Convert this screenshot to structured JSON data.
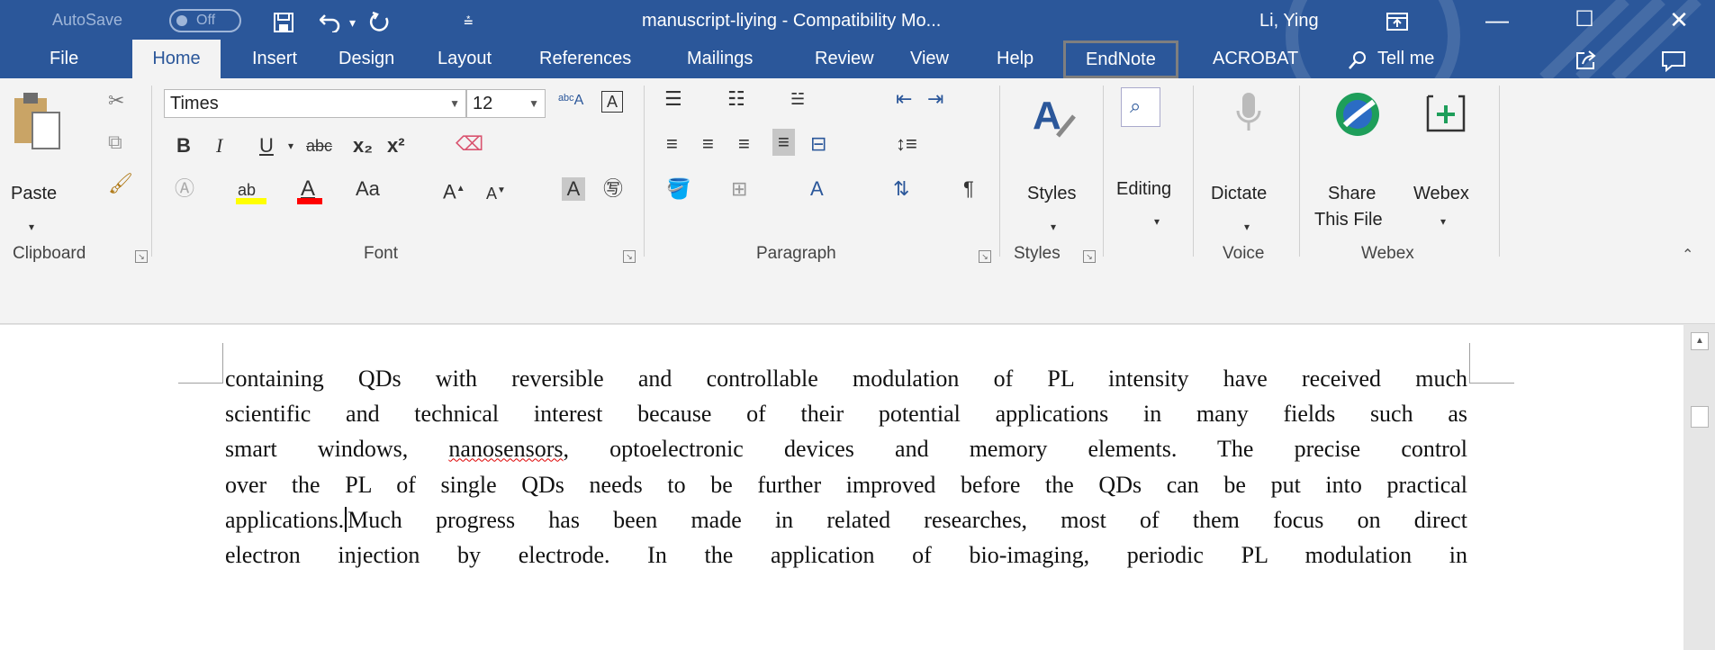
{
  "titlebar": {
    "autosave_label": "AutoSave",
    "autosave_state": "Off",
    "doc_title": "manuscript-liying  -  Compatibility Mo...",
    "user_name": "Li, Ying"
  },
  "tabs": [
    "File",
    "Home",
    "Insert",
    "Design",
    "Layout",
    "References",
    "Mailings",
    "Review",
    "View",
    "Help",
    "EndNote",
    "ACROBAT"
  ],
  "tell_me": "Tell me",
  "ribbon": {
    "clipboard": {
      "paste_label": "Paste",
      "group_label": "Clipboard"
    },
    "font": {
      "font_name": "Times",
      "font_size": "12",
      "group_label": "Font",
      "change_case": "Aa"
    },
    "paragraph": {
      "group_label": "Paragraph"
    },
    "styles": {
      "label": "Styles",
      "group_label": "Styles"
    },
    "editing": {
      "label": "Editing"
    },
    "voice": {
      "label": "Dictate",
      "group_label": "Voice"
    },
    "webex": {
      "share_line1": "Share",
      "share_line2": "This File",
      "webex_label": "Webex",
      "group_label": "Webex"
    }
  },
  "document": {
    "lines": [
      "containing QDs with reversible and controllable modulation of PL intensity have received much",
      "scientific and technical interest because of their potential applications in many fields such as",
      {
        "before": "smart windows, ",
        "misspelled": "nanosensors",
        "after": ", optoelectronic devices and memory elements. The precise control"
      },
      "over the PL of single QDs needs to be further improved before the QDs can be put into practical",
      {
        "before": "applications.",
        "after": "Much progress has been made in related researches, most of them focus on direct"
      },
      "electron injection by electrode. In the application of bio-imaging, periodic PL modulation in"
    ]
  },
  "colors": {
    "title_blue": "#2b579a",
    "ribbon_bg": "#f3f3f3",
    "highlight_yellow": "#ffff00",
    "font_red": "#ff0000"
  }
}
